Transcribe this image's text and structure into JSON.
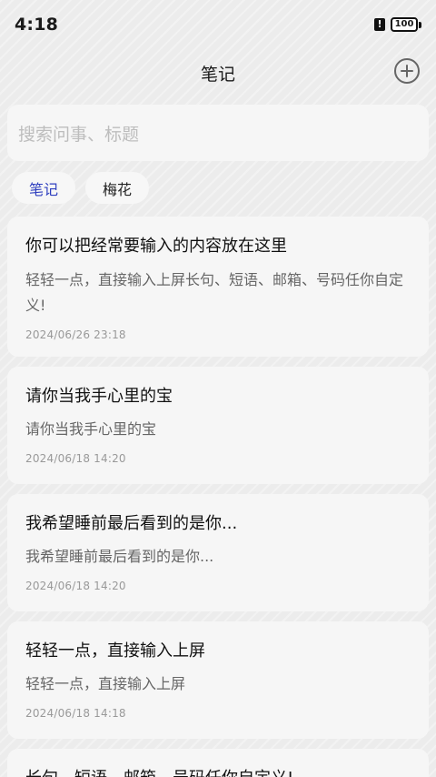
{
  "status": {
    "time": "4:18",
    "battery": "100"
  },
  "header": {
    "title": "笔记"
  },
  "search": {
    "placeholder": "搜索问事、标题"
  },
  "chips": [
    {
      "label": "笔记",
      "active": true
    },
    {
      "label": "梅花",
      "active": false
    }
  ],
  "notes": [
    {
      "title": "你可以把经常要输入的内容放在这里",
      "body": "轻轻一点，直接输入上屏长句、短语、邮箱、号码任你自定义!",
      "date": "2024/06/26 23:18"
    },
    {
      "title": "请你当我手心里的宝",
      "body": "请你当我手心里的宝",
      "date": "2024/06/18 14:20"
    },
    {
      "title": "我希望睡前最后看到的是你...",
      "body": "我希望睡前最后看到的是你...",
      "date": "2024/06/18 14:20"
    },
    {
      "title": "轻轻一点，直接输入上屏",
      "body": "轻轻一点，直接输入上屏",
      "date": "2024/06/18 14:18"
    },
    {
      "title": "长句、短语、邮箱、号码任你自定义!",
      "body": "",
      "date": ""
    }
  ],
  "colors": {
    "accent": "#2f3fbf",
    "background": "#ececec",
    "card": "#f6f6f6"
  }
}
